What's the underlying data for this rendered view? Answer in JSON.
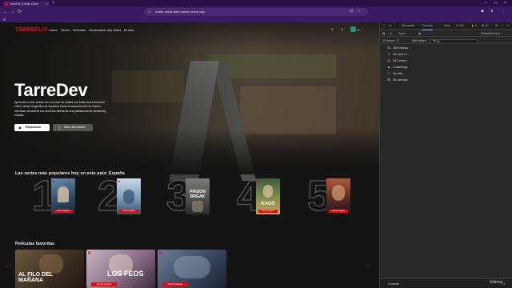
{
  "browser": {
    "tab_title": "TarreFlix | Netflix Clone",
    "url": "netflix-clone-tarre-westc.vercel.app",
    "bookmark_label": "⊞"
  },
  "site": {
    "logo": "TARREFLIX",
    "nav": [
      "Inicio",
      "Series",
      "Películas",
      "Novedades más vistas",
      "Mi lista"
    ],
    "hero": {
      "title": "TarreDev",
      "description": "Aprende a crear desde cero un clon de Netflix con todas sus funciones: Clerk, desde la gestión de usuarios hasta la reproducción de videos, mientras descubres los secretos detrás de una plataforma de streaming exitosa.",
      "play_label": "Reproducir",
      "info_label": "Más información"
    },
    "top10": {
      "title": "Las series más populares hoy en este país: España",
      "items": [
        {
          "rank": "1",
          "ribbon": "Recién llegado",
          "title": ""
        },
        {
          "rank": "2",
          "ribbon": "Recién llegado",
          "title": ""
        },
        {
          "rank": "3",
          "ribbon": "",
          "title": "PRISON BREAK"
        },
        {
          "rank": "4",
          "ribbon": "Recién llegado",
          "title": "KAOS"
        },
        {
          "rank": "5",
          "ribbon": "Recién llegado",
          "title": ""
        }
      ]
    },
    "favorites": {
      "title": "Películas favoritas",
      "items": [
        {
          "title": "AL FILO DEL MAÑANA",
          "ribbon": ""
        },
        {
          "title": "LOS FEOS",
          "ribbon": "Recién llegado"
        },
        {
          "title": "",
          "ribbon": "Recién llegado"
        }
      ]
    }
  },
  "devtools": {
    "tabs": [
      "Elements",
      "Console",
      "Sources"
    ],
    "error_count": "341",
    "warn_count": "2",
    "info_count": "12",
    "top_label": "top",
    "filter_placeholder": "Filter",
    "default_levels": "Default levels",
    "issues_label": "12 Issues:",
    "issues_count": "12",
    "hidden_label": "666 hidden",
    "sidebar": [
      {
        "icon": "list-icon",
        "label": "398 messa..."
      },
      {
        "icon": "user-icon",
        "label": "No user m..."
      },
      {
        "icon": "error-icon",
        "label": "341 errors"
      },
      {
        "icon": "warning-icon",
        "label": "2 warnings"
      },
      {
        "icon": "info-icon",
        "label": "No info"
      },
      {
        "icon": "verbose-icon",
        "label": "55 verbose"
      }
    ],
    "drawer_tab": "Console"
  },
  "watermark": "Udemy"
}
